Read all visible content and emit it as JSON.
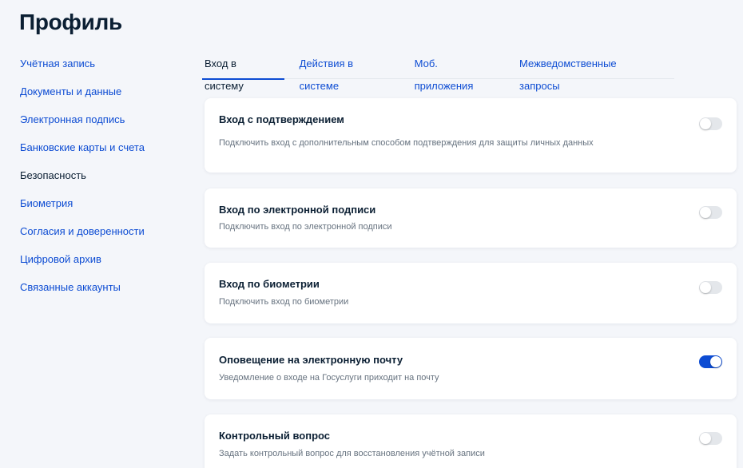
{
  "page": {
    "title": "Профиль"
  },
  "sidebar": {
    "items": [
      {
        "label": "Учётная запись"
      },
      {
        "label": "Документы и данные"
      },
      {
        "label": "Электронная подпись"
      },
      {
        "label": "Банковские карты и счета"
      },
      {
        "label": "Безопасность"
      },
      {
        "label": "Биометрия"
      },
      {
        "label": "Согласия и доверенности"
      },
      {
        "label": "Цифровой архив"
      },
      {
        "label": "Связанные аккаунты"
      }
    ],
    "active": "Безопасность"
  },
  "tabs": [
    {
      "label": "Вход в систему"
    },
    {
      "label": "Действия в системе"
    },
    {
      "label": "Моб. приложения"
    },
    {
      "label": "Межведомственные запросы"
    }
  ],
  "active_tab": "Вход в систему",
  "settings": [
    {
      "title": "Вход с подтверждением",
      "description": "Подключить вход с дополнительным способом подтверждения для защиты личных данных",
      "enabled": false
    },
    {
      "title": "Вход по электронной подписи",
      "description": "Подключить вход по электронной подписи",
      "enabled": false
    },
    {
      "title": "Вход по биометрии",
      "description": "Подключить вход по биометрии",
      "enabled": false
    },
    {
      "title": "Оповещение на электронную почту",
      "description": "Уведомление о входе на Госуслуги приходит на почту",
      "enabled": true
    },
    {
      "title": "Контрольный вопрос",
      "description": "Задать контрольный вопрос для восстановления учётной записи",
      "enabled": false
    }
  ],
  "colors": {
    "accent": "#0d4cd3",
    "background": "#f4f6fa",
    "card": "#ffffff",
    "text": "#0b1f33",
    "muted": "#66727f",
    "toggle_off": "#e4e7eb"
  }
}
